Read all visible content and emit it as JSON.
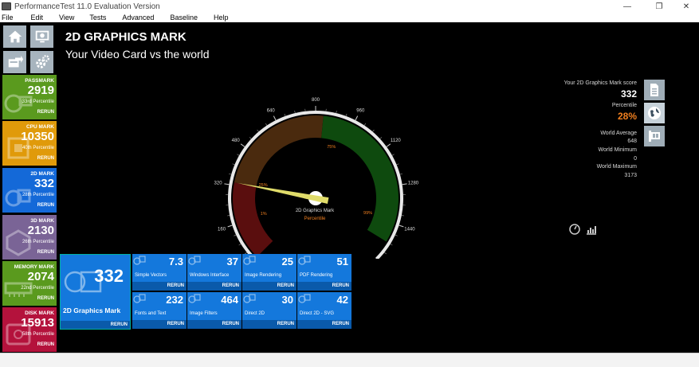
{
  "window": {
    "title": "PerformanceTest 11.0 Evaluation Version"
  },
  "menu": [
    "File",
    "Edit",
    "View",
    "Tests",
    "Advanced",
    "Baseline",
    "Help"
  ],
  "nav_icons": [
    "home-icon",
    "system-info-icon",
    "export-icon",
    "settings-icon"
  ],
  "heading": "2D GRAPHICS MARK",
  "subheading": "Your Video Card vs the world",
  "sidebar": [
    {
      "label": "PASSMARK",
      "value": "2919",
      "percentile": "33rd Percentile",
      "rerun": "RERUN",
      "color": "#5a9a1e"
    },
    {
      "label": "CPU MARK",
      "value": "10350",
      "percentile": "40th Percentile",
      "rerun": "RERUN",
      "color": "#e09a0a"
    },
    {
      "label": "2D MARK",
      "value": "332",
      "percentile": "28th Percentile",
      "rerun": "RERUN",
      "color": "#1469d8"
    },
    {
      "label": "3D MARK",
      "value": "2130",
      "percentile": "26th Percentile",
      "rerun": "RERUN",
      "color": "#7a6496"
    },
    {
      "label": "MEMORY MARK",
      "value": "2074",
      "percentile": "22nd Percentile",
      "rerun": "RERUN",
      "color": "#5a9a1e"
    },
    {
      "label": "DISK MARK",
      "value": "15913",
      "percentile": "58th Percentile",
      "rerun": "RERUN",
      "color": "#b4123c"
    }
  ],
  "gauge": {
    "value": 332,
    "max": 1600,
    "ticks": [
      "0",
      "160",
      "320",
      "480",
      "640",
      "800",
      "960",
      "1120",
      "1280",
      "1440",
      "1600"
    ],
    "percentile_marks": [
      "1%",
      "25%",
      "75%",
      "99%"
    ],
    "title": "2D Graphics Mark",
    "subtitle": "Percentile",
    "colors": {
      "red": "#5a0e0e",
      "brown": "#4a2a0e",
      "green": "#0e4a0e",
      "needle": "#e0dc6a"
    }
  },
  "right_panel": {
    "score_label": "Your 2D Graphics Mark score",
    "score": "332",
    "percentile_label": "Percentile",
    "percentile": "28%",
    "world_avg_label": "World Average",
    "world_avg": "648",
    "world_min_label": "World Minimum",
    "world_min": "0",
    "world_max_label": "World Maximum",
    "world_max": "3173",
    "buttons": [
      "report-icon",
      "globe-icon",
      "hardware-icon"
    ]
  },
  "main_tile": {
    "value": "332",
    "label": "2D Graphics Mark",
    "rerun": "RERUN"
  },
  "subtests": [
    {
      "value": "7.3",
      "label": "Simple Vectors",
      "rerun": "RERUN"
    },
    {
      "value": "37",
      "label": "Windows Interface",
      "rerun": "RERUN"
    },
    {
      "value": "25",
      "label": "Image Rendering",
      "rerun": "RERUN"
    },
    {
      "value": "51",
      "label": "PDF Rendering",
      "rerun": "RERUN"
    },
    {
      "value": "232",
      "label": "Fonts and Text",
      "rerun": "RERUN"
    },
    {
      "value": "464",
      "label": "Image Filters",
      "rerun": "RERUN"
    },
    {
      "value": "30",
      "label": "Direct 2D",
      "rerun": "RERUN"
    },
    {
      "value": "42",
      "label": "Direct 2D - SVG",
      "rerun": "RERUN"
    }
  ]
}
